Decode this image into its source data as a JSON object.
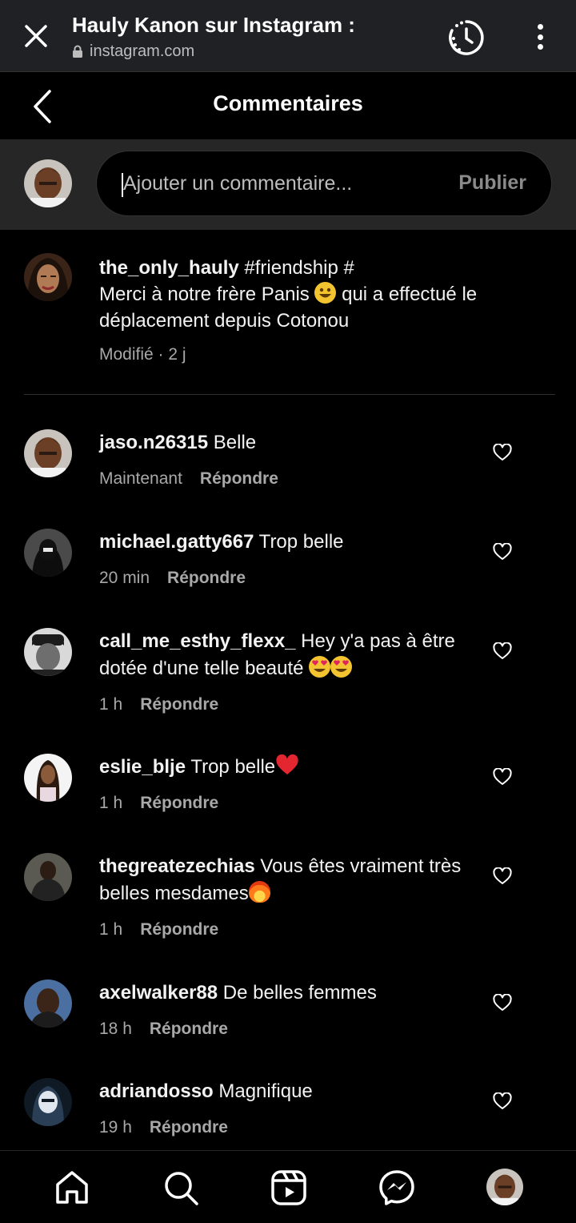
{
  "browser": {
    "title": "Hauly Kanon sur Instagram :",
    "url": "instagram.com"
  },
  "header": {
    "title": "Commentaires"
  },
  "composer": {
    "placeholder": "Ajouter un commentaire...",
    "publish_label": "Publier"
  },
  "caption": {
    "username": "the_only_hauly",
    "line1_after_username": " #friendship #",
    "line2_before_emoji": "Merci à notre frère Panis ",
    "line2_after_emoji": " qui a effectué le déplacement depuis Cotonou",
    "meta": "Modifié · 2 j"
  },
  "comments": [
    {
      "username": "jaso.n26315",
      "text": " Belle",
      "time": "Maintenant",
      "reply": "Répondre"
    },
    {
      "username": "michael.gatty667",
      "text": " Trop belle",
      "time": "20 min",
      "reply": "Répondre"
    },
    {
      "username": "call_me_esthy_flexx_",
      "text": " Hey y'a pas à être dotée d'une telle beauté ",
      "time": "1 h",
      "reply": "Répondre"
    },
    {
      "username": "eslie_blje",
      "text": " Trop belle",
      "time": "1 h",
      "reply": "Répondre"
    },
    {
      "username": "thegreatezechias",
      "text": " Vous êtes vraiment très belles mesdames",
      "time": "1 h",
      "reply": "Répondre"
    },
    {
      "username": "axelwalker88",
      "text": " De belles femmes",
      "time": "18 h",
      "reply": "Répondre"
    },
    {
      "username": "adriandosso",
      "text": " Magnifique",
      "time": "19 h",
      "reply": "Répondre"
    }
  ],
  "icons": {
    "close": "close-icon",
    "lock": "lock-icon",
    "history": "history-icon",
    "menu": "more-vert-icon",
    "back": "chevron-left-icon",
    "like": "heart-outline-icon",
    "nav": [
      "home-icon",
      "search-icon",
      "reels-icon",
      "messenger-icon",
      "profile-avatar"
    ]
  },
  "colors": {
    "background": "#000000",
    "browser_bar": "#202124",
    "composer_bar": "#262626",
    "secondary_text": "#a8a8a8"
  }
}
